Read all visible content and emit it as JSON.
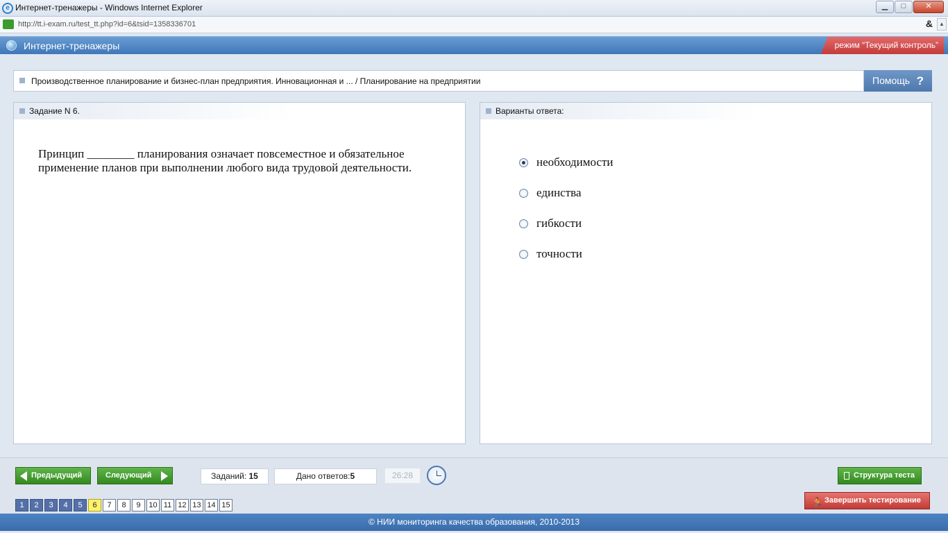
{
  "browser": {
    "window_title": "Интернет-тренажеры - Windows Internet Explorer",
    "url": "http://tt.i-exam.ru/test_tt.php?id=6&tsid=1358336701",
    "tools_label": "&"
  },
  "app": {
    "title": "Интернет-тренажеры",
    "mode_label": "режим “Текущий контроль”"
  },
  "breadcrumb": {
    "text": "Производственное планирование и бизнес-план предприятия. Инновационная и ... / Планирование на предприятии"
  },
  "help": {
    "label": "Помощь",
    "icon": "?"
  },
  "task": {
    "header": "Задание N 6.",
    "question": "Принцип ________ планирования означает повсеместное и обязательное применение планов при выполнении любого вида трудовой деятельности."
  },
  "answers": {
    "header": "Варианты ответа:",
    "options": [
      {
        "label": "необходимости",
        "selected": true
      },
      {
        "label": "единства",
        "selected": false
      },
      {
        "label": "гибкости",
        "selected": false
      },
      {
        "label": "точности",
        "selected": false
      }
    ]
  },
  "nav": {
    "prev_label": "Предыдущий",
    "next_label": "Следующий",
    "tasks_label": "Заданий:",
    "tasks_count": "15",
    "answered_label": "Дано ответов:",
    "answered_count": "5",
    "timer": "26:28",
    "structure_label": "Структура теста",
    "finish_label": "Завершить тестирование"
  },
  "pages": [
    {
      "n": "1",
      "state": "answered"
    },
    {
      "n": "2",
      "state": "answered"
    },
    {
      "n": "3",
      "state": "answered"
    },
    {
      "n": "4",
      "state": "answered"
    },
    {
      "n": "5",
      "state": "answered"
    },
    {
      "n": "6",
      "state": "current"
    },
    {
      "n": "7",
      "state": "empty"
    },
    {
      "n": "8",
      "state": "empty"
    },
    {
      "n": "9",
      "state": "empty"
    },
    {
      "n": "10",
      "state": "empty"
    },
    {
      "n": "11",
      "state": "empty"
    },
    {
      "n": "12",
      "state": "empty"
    },
    {
      "n": "13",
      "state": "empty"
    },
    {
      "n": "14",
      "state": "empty"
    },
    {
      "n": "15",
      "state": "empty"
    }
  ],
  "footer": {
    "text": "© НИИ мониторинга качества образования, 2010-2013"
  },
  "colors": {
    "header_blue": "#3f77b8",
    "mode_red": "#c43a3a",
    "button_green": "#33891f",
    "finish_red": "#c23b36",
    "page_answered": "#5470a8",
    "page_current": "#fff26a"
  }
}
